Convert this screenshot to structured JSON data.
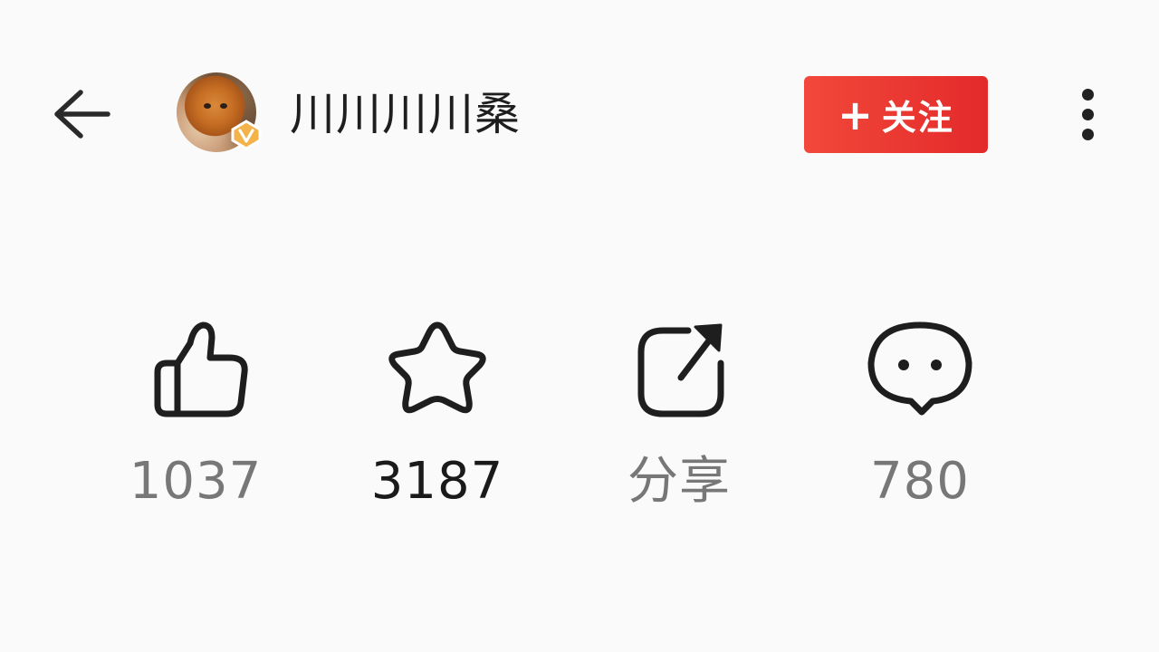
{
  "header": {
    "back_icon": "arrow-left-icon",
    "user_name": "川川川川桑",
    "verified_badge_icon": "v-badge-icon",
    "follow_button": {
      "plus": "+",
      "label": "关注",
      "color": "#e8322f"
    },
    "more_icon": "more-vertical-icon"
  },
  "actions": {
    "like": {
      "icon": "thumbs-up-icon",
      "count": "1037"
    },
    "favorite": {
      "icon": "star-icon",
      "count": "3187"
    },
    "share": {
      "icon": "share-icon",
      "label": "分享"
    },
    "comment": {
      "icon": "comment-bubble-icon",
      "count": "780"
    }
  },
  "colors": {
    "background": "#fafafa",
    "text_primary": "#1a1a1a",
    "text_secondary": "#777777",
    "accent": "#e8322f",
    "badge": "#f0a43a"
  }
}
